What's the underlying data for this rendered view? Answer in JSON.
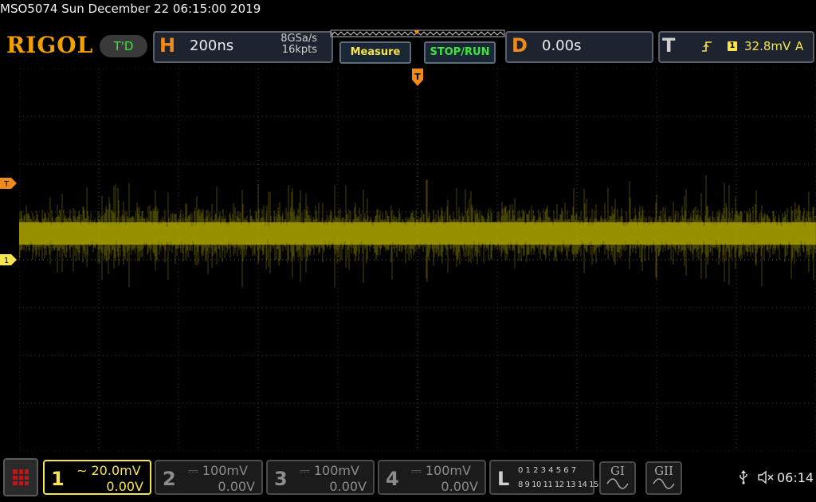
{
  "status": {
    "title": "MSO5074  Sun December 22 06:15:00 2019",
    "clock": "06:14"
  },
  "brand": {
    "logo": "RIGOL",
    "mode": "T'D"
  },
  "horizontal": {
    "letter": "H",
    "timebase": "200ns",
    "sample_rate": "8GSa/s",
    "memory_depth": "16kpts"
  },
  "buttons": {
    "measure": "Measure",
    "stop_run": "STOP/RUN"
  },
  "delay": {
    "letter": "D",
    "value": "0.00s"
  },
  "trigger": {
    "letter": "T",
    "source": "1",
    "level": "32.8mV",
    "mode": "A",
    "marker": "T"
  },
  "channels": [
    {
      "num": "1",
      "scale": "20.0mV",
      "offset": "0.00V",
      "coupling": "AC",
      "color": "#f6e54c",
      "active": true
    },
    {
      "num": "2",
      "scale": "100mV",
      "offset": "0.00V",
      "coupling": "DC",
      "color": "#8c8c8c",
      "active": false
    },
    {
      "num": "3",
      "scale": "100mV",
      "offset": "0.00V",
      "coupling": "DC",
      "color": "#8c8c8c",
      "active": false
    },
    {
      "num": "4",
      "scale": "100mV",
      "offset": "0.00V",
      "coupling": "DC",
      "color": "#8c8c8c",
      "active": false
    }
  ],
  "logic": {
    "letter": "L",
    "row1": "0 1 2 3  4 5 6 7",
    "row2": "8 9 10 11 12 13 14 15"
  },
  "generators": {
    "g1": "GI",
    "g2": "GII"
  },
  "colors": {
    "accent": "#f08a1a",
    "trace": "#d9d000",
    "grid": "#3a3a3a",
    "ch1": "#f6e54c",
    "green": "#3ce63c"
  },
  "icons": [
    "usb-icon",
    "speaker-muted-icon",
    "menu-grid-icon",
    "sine-wave-icon"
  ]
}
